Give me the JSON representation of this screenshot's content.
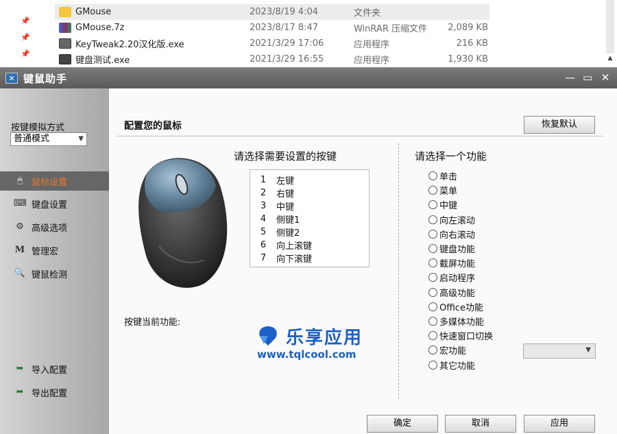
{
  "explorer": {
    "files": [
      {
        "name": "GMouse",
        "date": "2023/8/19 4:04",
        "type": "文件夹",
        "size": "",
        "icon": "folder-icon",
        "color": "#f5c542"
      },
      {
        "name": "GMouse.7z",
        "date": "2023/8/17 8:47",
        "type": "WinRAR 压缩文件",
        "size": "2,089 KB",
        "icon": "winrar-icon",
        "color": "#8b2d6b"
      },
      {
        "name": "KeyTweak2.20汉化版.exe",
        "date": "2021/3/29 17:06",
        "type": "应用程序",
        "size": "216 KB",
        "icon": "keyboard-app-icon",
        "color": "#555555"
      },
      {
        "name": "键盘测试.exe",
        "date": "2021/3/29 16:55",
        "type": "应用程序",
        "size": "1,930 KB",
        "icon": "keyboard-app-icon",
        "color": "#444444"
      }
    ]
  },
  "window": {
    "title": "键鼠助手",
    "controls": {
      "minimize": "—",
      "maximize": "▭",
      "close": "✕"
    }
  },
  "sidebar": {
    "mode_label": "按键模拟方式",
    "mode_value": "普通模式",
    "items": [
      {
        "label": "鼠标设置",
        "icon": "mouse-icon",
        "active": true
      },
      {
        "label": "键盘设置",
        "icon": "keyboard-icon",
        "active": false
      },
      {
        "label": "高级选项",
        "icon": "gear-icon",
        "active": false
      },
      {
        "label": "管理宏",
        "icon": "macro-m-icon",
        "active": false
      },
      {
        "label": "键鼠检测",
        "icon": "magnifier-icon",
        "active": false
      }
    ],
    "bottom": [
      {
        "label": "导入配置",
        "icon": "import-icon"
      },
      {
        "label": "导出配置",
        "icon": "export-icon"
      }
    ]
  },
  "content": {
    "heading": "配置您的鼠标",
    "restore_button": "恢复默认",
    "keys_title": "请选择需要设置的按键",
    "keys": [
      {
        "num": "1",
        "label": "左键"
      },
      {
        "num": "2",
        "label": "右键"
      },
      {
        "num": "3",
        "label": "中键"
      },
      {
        "num": "4",
        "label": "侧键1"
      },
      {
        "num": "5",
        "label": "侧键2"
      },
      {
        "num": "6",
        "label": "向上滚键"
      },
      {
        "num": "7",
        "label": "向下滚键"
      }
    ],
    "current_label": "按键当前功能:",
    "func_title": "请选择一个功能",
    "functions": [
      "单击",
      "菜单",
      "中键",
      "向左滚动",
      "向右滚动",
      "键盘功能",
      "截屏功能",
      "启动程序",
      "高级功能",
      "Office功能",
      "多媒体功能",
      "快速窗口切换",
      "宏功能",
      "其它功能"
    ],
    "buttons": {
      "ok": "确定",
      "cancel": "取消",
      "apply": "应用"
    }
  },
  "watermark": {
    "text": "乐享应用",
    "url": "www.tqlcool.com"
  },
  "colors": {
    "accent": "#e87a32",
    "titlebar": "#6a6a6a",
    "watermark": "#1b5fc7"
  }
}
